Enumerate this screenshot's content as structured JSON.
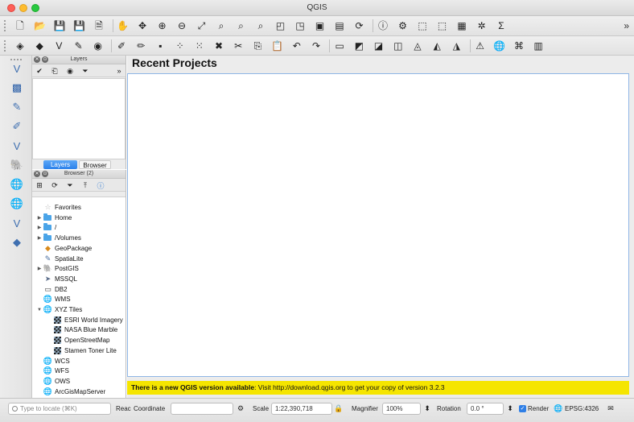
{
  "window": {
    "title": "QGIS"
  },
  "toolbar1": {
    "buttons": [
      {
        "name": "new-project-icon",
        "glyph": "🗋"
      },
      {
        "name": "open-project-icon",
        "glyph": "📂"
      },
      {
        "name": "save-project-icon",
        "glyph": "💾"
      },
      {
        "name": "save-as-icon",
        "glyph": "💾"
      },
      {
        "name": "print-layout-icon",
        "glyph": "🗎"
      },
      {
        "name": "pan-hand-icon",
        "glyph": "✋"
      },
      {
        "name": "pan-to-selection-icon",
        "glyph": "✥"
      },
      {
        "name": "zoom-in-icon",
        "glyph": "⊕"
      },
      {
        "name": "zoom-out-icon",
        "glyph": "⊖"
      },
      {
        "name": "zoom-full-icon",
        "glyph": "⤢"
      },
      {
        "name": "zoom-selection-icon",
        "glyph": "⌕"
      },
      {
        "name": "zoom-layer-icon",
        "glyph": "⌕"
      },
      {
        "name": "zoom-native-icon",
        "glyph": "⌕"
      },
      {
        "name": "zoom-last-icon",
        "glyph": "◰"
      },
      {
        "name": "zoom-next-icon",
        "glyph": "◳"
      },
      {
        "name": "new-map-view-icon",
        "glyph": "▣"
      },
      {
        "name": "bookmark-icon",
        "glyph": "▤"
      },
      {
        "name": "refresh-icon",
        "glyph": "⟳"
      },
      {
        "name": "identify-icon",
        "glyph": "ⓘ"
      },
      {
        "name": "run-action-icon",
        "glyph": "⚙"
      },
      {
        "name": "select-features-icon",
        "glyph": "⬚"
      },
      {
        "name": "deselect-icon",
        "glyph": "⬚"
      },
      {
        "name": "attribute-table-icon",
        "glyph": "▦"
      },
      {
        "name": "field-calculator-icon",
        "glyph": "✲"
      },
      {
        "name": "statistics-icon",
        "glyph": "Σ"
      }
    ],
    "overflow_label": "»"
  },
  "toolbar2": {
    "buttons": [
      {
        "name": "data-source-manager-icon",
        "glyph": "◈"
      },
      {
        "name": "new-geopackage-icon",
        "glyph": "◆"
      },
      {
        "name": "new-virtual-layer-icon",
        "glyph": "V"
      },
      {
        "name": "digitize-icon",
        "glyph": "✎"
      },
      {
        "name": "new-shapefile-icon",
        "glyph": "◉"
      },
      {
        "name": "current-edits-icon",
        "glyph": "✐"
      },
      {
        "name": "toggle-editing-icon",
        "glyph": "✏"
      },
      {
        "name": "save-edits-icon",
        "glyph": "▪"
      },
      {
        "name": "add-feature-icon",
        "glyph": "⁘"
      },
      {
        "name": "vertex-tool-icon",
        "glyph": "⁙"
      },
      {
        "name": "delete-selected-icon",
        "glyph": "✖"
      },
      {
        "name": "cut-features-icon",
        "glyph": "✂"
      },
      {
        "name": "copy-features-icon",
        "glyph": "⎘"
      },
      {
        "name": "paste-features-icon",
        "glyph": "📋"
      },
      {
        "name": "undo-icon",
        "glyph": "↶"
      },
      {
        "name": "redo-icon",
        "glyph": "↷"
      },
      {
        "name": "label-icon",
        "glyph": "▭"
      },
      {
        "name": "label-pin-icon",
        "glyph": "◩"
      },
      {
        "name": "label-show-icon",
        "glyph": "◪"
      },
      {
        "name": "label-move-icon",
        "glyph": "◫"
      },
      {
        "name": "label-rotate-icon",
        "glyph": "◬"
      },
      {
        "name": "label-change-icon",
        "glyph": "◭"
      },
      {
        "name": "label-diagram-icon",
        "glyph": "◮"
      },
      {
        "name": "geometry-checker-icon",
        "glyph": "⚠"
      },
      {
        "name": "georeferencer-icon",
        "glyph": "🌐"
      },
      {
        "name": "python-console-icon",
        "glyph": "⌘"
      },
      {
        "name": "metasearch-icon",
        "glyph": "▥"
      }
    ]
  },
  "left_toolbar": {
    "buttons": [
      {
        "name": "add-virtual-layer-icon",
        "glyph": "V"
      },
      {
        "name": "add-raster-layer-icon",
        "glyph": "▩"
      },
      {
        "name": "add-spatialite-layer-icon",
        "glyph": "✎"
      },
      {
        "name": "add-delimited-text-icon",
        "glyph": "✐"
      },
      {
        "name": "add-vector-layer-icon",
        "glyph": "V"
      },
      {
        "name": "add-postgis-layer-icon",
        "glyph": "🐘"
      },
      {
        "name": "add-wms-layer-icon",
        "glyph": "🌐"
      },
      {
        "name": "add-wcs-layer-icon",
        "glyph": "🌐"
      },
      {
        "name": "add-wfs-layer-icon",
        "glyph": "V"
      },
      {
        "name": "add-geopackage-layer-icon",
        "glyph": "◆"
      }
    ]
  },
  "layers_panel": {
    "title": "Layers",
    "tools_overflow": "»",
    "tabs": [
      {
        "label": "Layers",
        "active": true
      },
      {
        "label": "Browser",
        "active": false
      }
    ]
  },
  "browser_panel": {
    "title": "Browser (2)",
    "items": [
      {
        "label": "Favorites",
        "icon": "star",
        "expand": "",
        "indent": 0
      },
      {
        "label": "Home",
        "icon": "folder",
        "expand": "▶",
        "indent": 0
      },
      {
        "label": "/",
        "icon": "folder",
        "expand": "▶",
        "indent": 0
      },
      {
        "label": "/Volumes",
        "icon": "folder",
        "expand": "▶",
        "indent": 0
      },
      {
        "label": "GeoPackage",
        "icon": "geopackage",
        "expand": "",
        "indent": 0
      },
      {
        "label": "SpatiaLite",
        "icon": "spatialite",
        "expand": "",
        "indent": 0
      },
      {
        "label": "PostGIS",
        "icon": "postgis",
        "expand": "▶",
        "indent": 0
      },
      {
        "label": "MSSQL",
        "icon": "mssql",
        "expand": "",
        "indent": 0
      },
      {
        "label": "DB2",
        "icon": "db2",
        "expand": "",
        "indent": 0
      },
      {
        "label": "WMS",
        "icon": "globe",
        "expand": "",
        "indent": 0
      },
      {
        "label": "XYZ Tiles",
        "icon": "globe",
        "expand": "▼",
        "indent": 0
      },
      {
        "label": "ESRI World Imagery",
        "icon": "tile",
        "expand": "",
        "indent": 1
      },
      {
        "label": "NASA Blue Marble",
        "icon": "tile",
        "expand": "",
        "indent": 1
      },
      {
        "label": "OpenStreetMap",
        "icon": "tile",
        "expand": "",
        "indent": 1
      },
      {
        "label": "Stamen Toner Lite",
        "icon": "tile",
        "expand": "",
        "indent": 1
      },
      {
        "label": "WCS",
        "icon": "globe",
        "expand": "",
        "indent": 0
      },
      {
        "label": "WFS",
        "icon": "globe",
        "expand": "",
        "indent": 0
      },
      {
        "label": "OWS",
        "icon": "globe",
        "expand": "",
        "indent": 0
      },
      {
        "label": "ArcGisMapServer",
        "icon": "globe",
        "expand": "",
        "indent": 0
      }
    ]
  },
  "main": {
    "title": "Recent Projects",
    "notice_bold": "There is a new QGIS version available",
    "notice_rest": ": Visit http://download.qgis.org to get your copy of version 3.2.3"
  },
  "statusbar": {
    "locate_placeholder": "Type to locate (⌘K)",
    "ready_text": "Reac",
    "coordinate_label": "Coordinate",
    "coordinate_value": "",
    "scale_label": "Scale",
    "scale_value": "1:22,390,718",
    "magnifier_label": "Magnifier",
    "magnifier_value": "100%",
    "rotation_label": "Rotation",
    "rotation_value": "0.0 °",
    "render_label": "Render",
    "crs_label": "EPSG:4326"
  },
  "colors": {
    "notice_bg": "#f5e500",
    "tab_active": "#2b81ea",
    "projects_border": "#8fb6e6"
  }
}
